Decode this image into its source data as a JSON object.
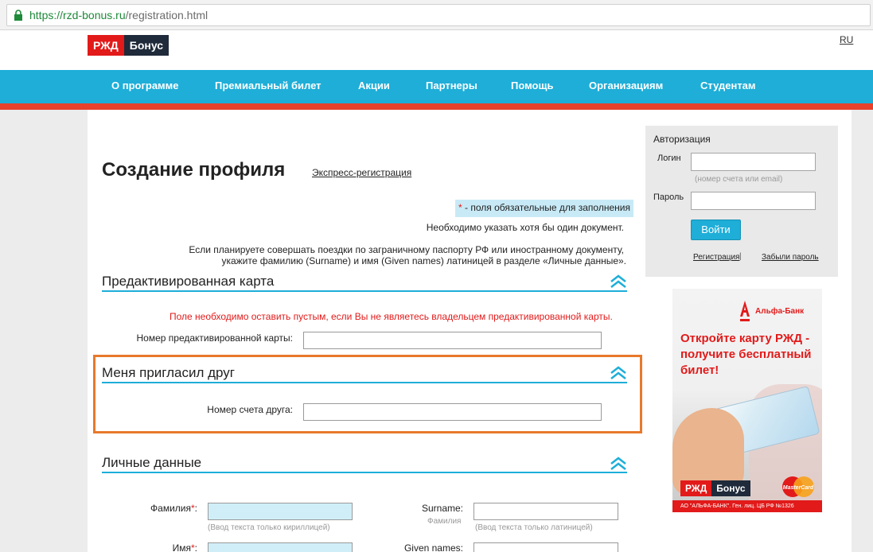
{
  "browser": {
    "url_host": "https://rzd-bonus.ru",
    "url_path": "/registration.html"
  },
  "header": {
    "logo": {
      "rzd": "РЖД",
      "bonus": "Бонус"
    },
    "lang": "RU",
    "nav": [
      "О программе",
      "Премиальный билет",
      "Акции",
      "Партнеры",
      "Помощь",
      "Организациям",
      "Студентам"
    ]
  },
  "page": {
    "title": "Создание профиля",
    "express_link": "Экспресс-регистрация",
    "required_star": "*",
    "required_note": " - поля обязательные для заполнения",
    "note_document": "Необходимо указать хотя бы один документ.",
    "note_foreign_1": "Если планируете совершать поездки по заграничному паспорту РФ или иностранному документу,",
    "note_foreign_2": "укажите фамилию (Surname) и имя (Given names) латиницей в разделе «Личные данные»."
  },
  "sections": {
    "preactivated": {
      "title": "Предактивированная карта",
      "warning": "Поле необходимо оставить пустым, если Вы не являетесь владельцем предактивированной карты.",
      "card_label": "Номер предактивированной карты:"
    },
    "invited": {
      "title": "Меня пригласил друг",
      "friend_label": "Номер счета друга:"
    },
    "personal": {
      "title": "Личные данные",
      "lastname_label": "Фамилия",
      "lastname_hint": "(Ввод текста только кириллицей)",
      "surname_label": "Surname:",
      "surname_sub": "Фамилия",
      "surname_hint": "(Ввод текста только латиницей)",
      "firstname_label": "Имя",
      "givenname_label": "Given names:",
      "star": "*",
      "colon": ":"
    }
  },
  "auth": {
    "title": "Авторизация",
    "login_label": "Логин",
    "login_hint": "(номер счета или email)",
    "password_label": "Пароль",
    "login_button": "Войти",
    "register_link": "Регистрация",
    "separator": "|",
    "forgot_link": "Забыли пароль"
  },
  "banner": {
    "bank_name": "Альфа-Банк",
    "headline": "Откройте карту РЖД - получите бесплатный билет!",
    "logo_rzd": "РЖД",
    "logo_bonus": "Бонус",
    "footer": "АО \"АЛЬФА-БАНК\". Ген. лиц. ЦБ РФ №1326",
    "mastercard": "MasterCard"
  },
  "colors": {
    "accent": "#1eaed8",
    "brand_red": "#e21a1a",
    "highlight": "#e8792b"
  }
}
